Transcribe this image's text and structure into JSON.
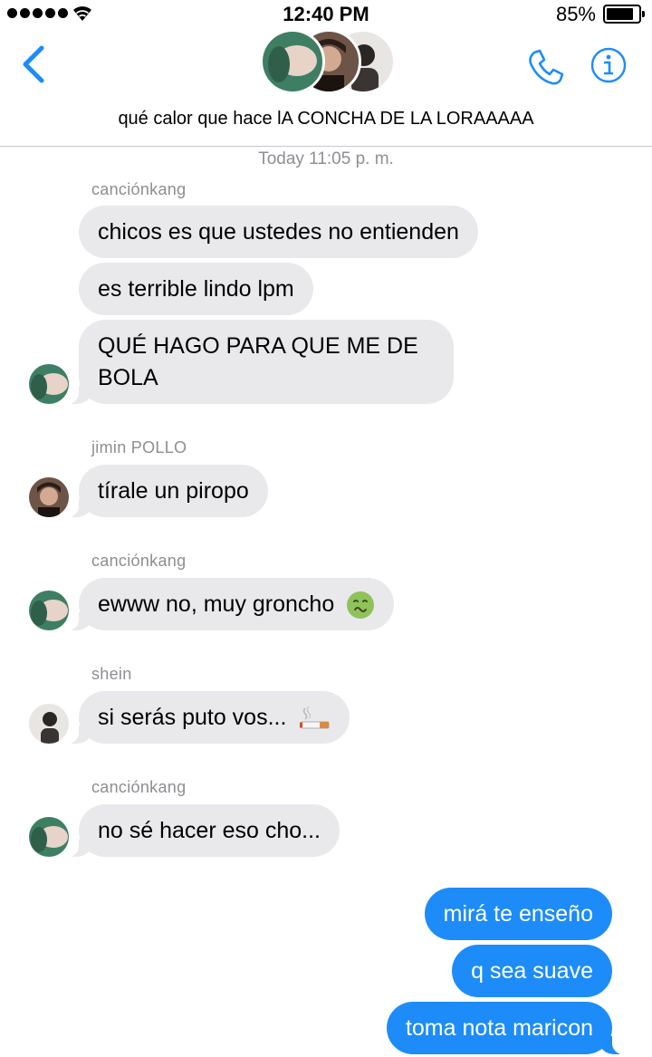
{
  "status_bar": {
    "time": "12:40 PM",
    "battery_percent": "85%",
    "battery_level": 0.85,
    "signal_bars": 5
  },
  "header": {
    "group_name": "qué calor que hace lA CONCHA DE LA LORAAAAA",
    "accent_color": "#1d8cf8"
  },
  "conversation": {
    "timestamp": "Today 11:05 p. m.",
    "groups": [
      {
        "sender": "canciónkang",
        "messages": [
          "chicos es que ustedes no entienden",
          "es terrible lindo lpm",
          "QUÉ HAGO PARA QUE ME DE",
          "BOLA"
        ]
      },
      {
        "sender": "jimin POLLO",
        "messages": [
          "tírale un piropo"
        ]
      },
      {
        "sender": "canciónkang",
        "messages": [
          "ewww no, muy groncho",
          "nauseated-face-emoji"
        ]
      },
      {
        "sender": "shein",
        "messages": [
          "si serás puto vos...",
          "cigarette-emoji"
        ]
      },
      {
        "sender": "canciónkang",
        "messages": [
          "no sé hacer eso cho..."
        ]
      }
    ],
    "outgoing": [
      "mirá te enseño",
      "q sea suave",
      "toma nota maricon"
    ]
  },
  "colors": {
    "incoming_bubble": "#e9e9eb",
    "outgoing_bubble": "#1d8cf8",
    "secondary_text": "#8e8e93"
  }
}
